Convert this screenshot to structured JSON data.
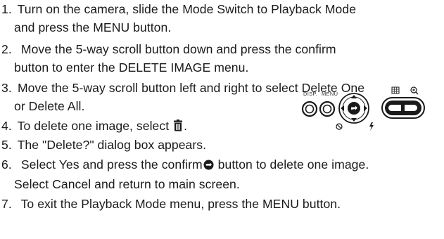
{
  "steps": [
    {
      "num": "1.",
      "line1": "Turn on the camera, slide the Mode Switch to Playback Mode",
      "line2": "and press the MENU button."
    },
    {
      "num": "2.",
      "line1": " Move the 5-way scroll button down and press the confirm",
      "line2": "button to enter the DELETE IMAGE menu."
    },
    {
      "num": "3.",
      "line1": "Move the 5-way scroll button left and right to select Delete One",
      "line2": "or Delete All."
    },
    {
      "num": "4.",
      "line1": "To delete one image, select",
      "line1_after": "."
    },
    {
      "num": "5.",
      "line1": "The \"Delete?\" dialog box appears."
    },
    {
      "num": "6.",
      "line1_before": " Select Yes and press the confirm",
      "line1_after": " button to delete one image.",
      "line2": "Select Cancel and return to main screen."
    },
    {
      "num": "7.",
      "line1": " To exit the Playback Mode menu, press the MENU button."
    }
  ],
  "icons": {
    "trash": "trash-icon",
    "confirm": "confirm-icon"
  },
  "camera_panel": {
    "disp_label": "DISP.",
    "menu_label": "MENU"
  }
}
